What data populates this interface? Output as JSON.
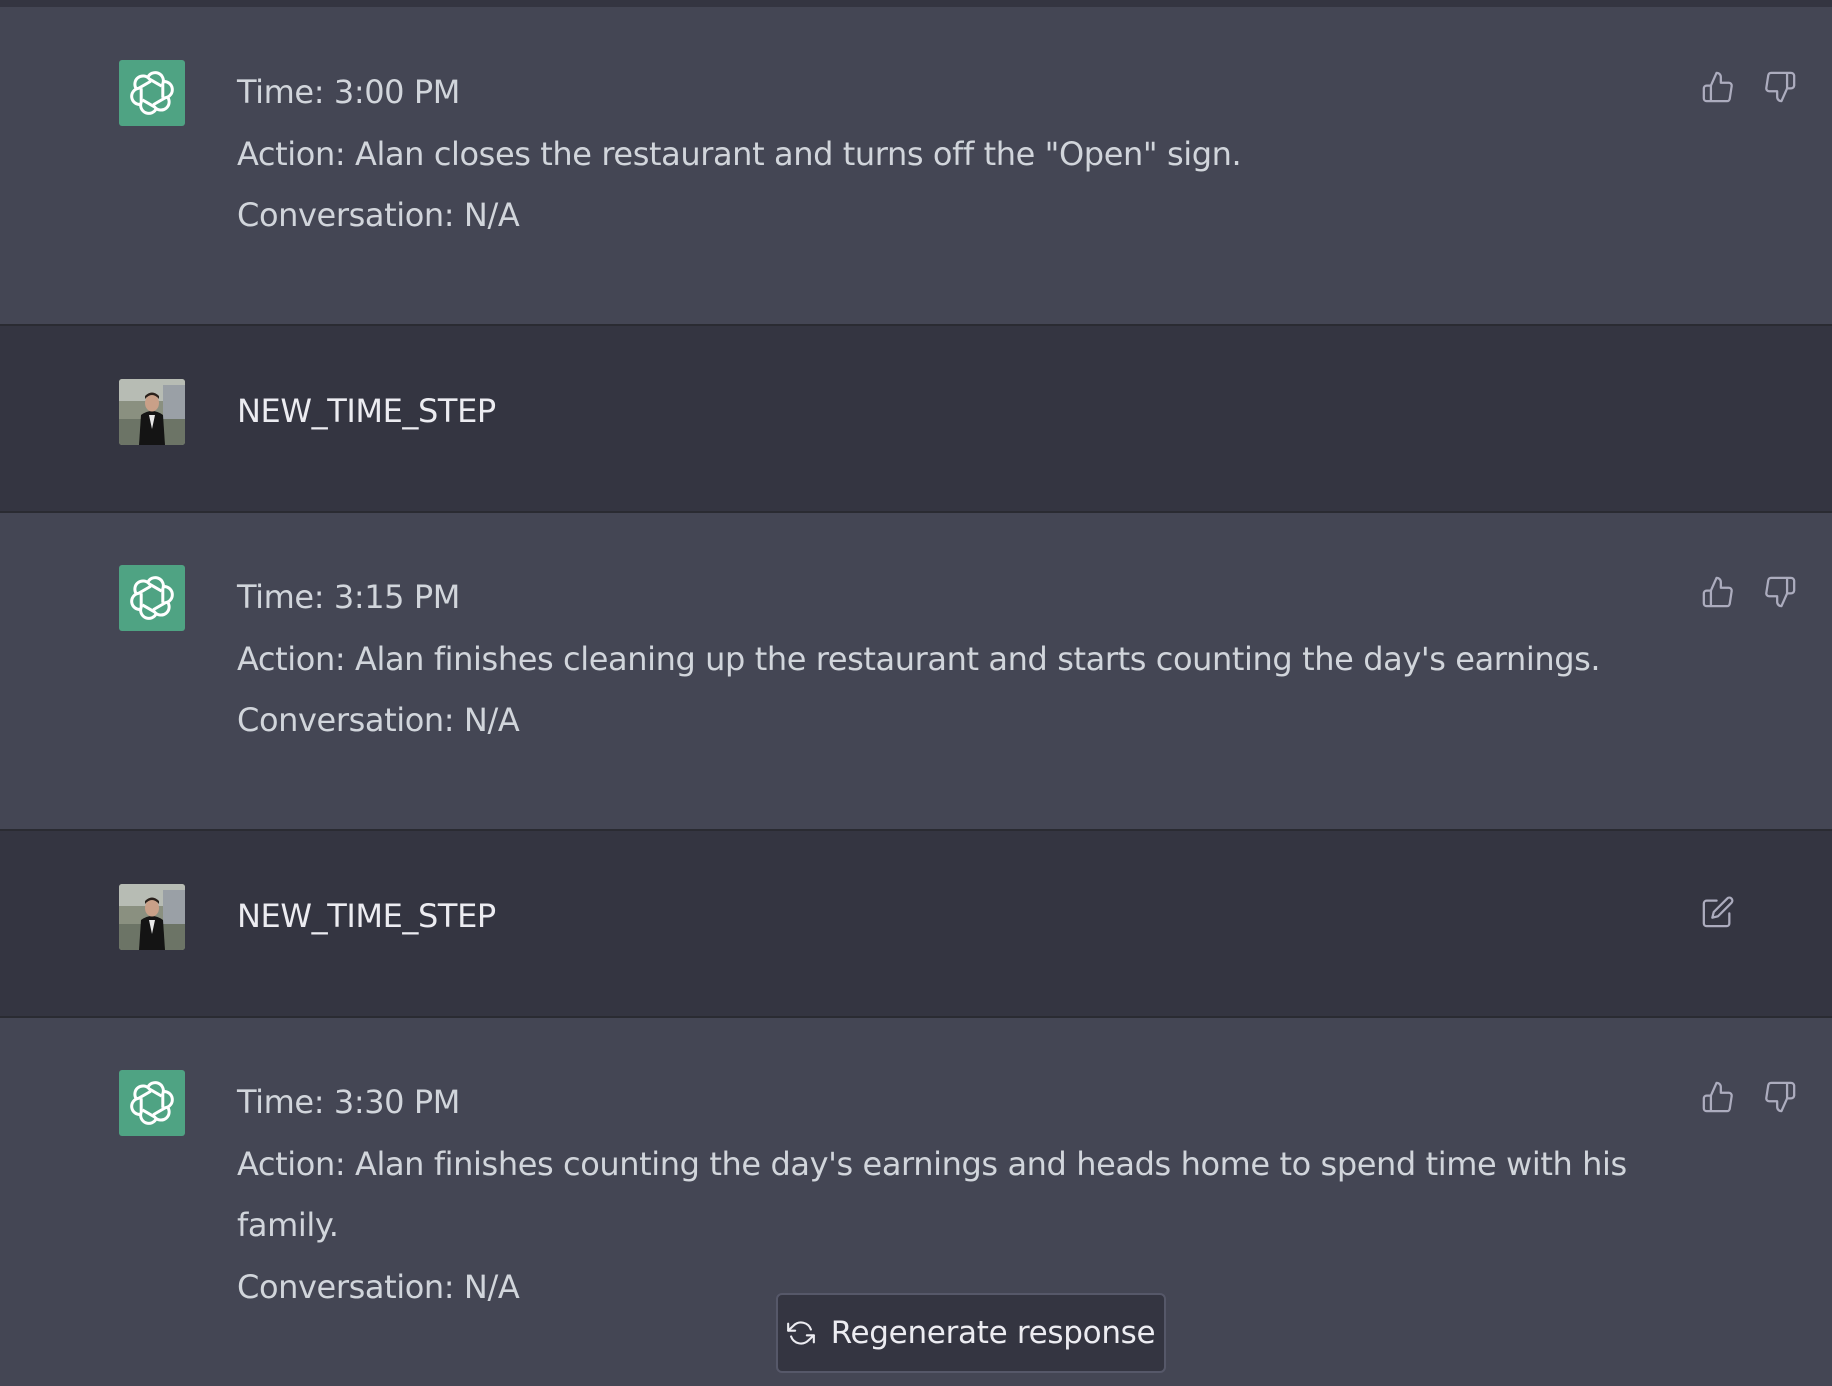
{
  "messages": [
    {
      "role": "assistant",
      "lines": [
        "Time: 3:00 PM",
        "Action: Alan closes the restaurant and turns off the \"Open\" sign.",
        "Conversation: N/A"
      ]
    },
    {
      "role": "user",
      "lines": [
        "NEW_TIME_STEP"
      ]
    },
    {
      "role": "assistant",
      "lines": [
        "Time: 3:15 PM",
        "Action: Alan finishes cleaning up the restaurant and starts counting the day's earnings.",
        "Conversation: N/A"
      ]
    },
    {
      "role": "user",
      "lines": [
        "NEW_TIME_STEP"
      ]
    },
    {
      "role": "assistant",
      "lines": [
        "Time: 3:30 PM",
        "Action: Alan finishes counting the day's earnings and heads home to spend time with his",
        "family.",
        "Conversation: N/A"
      ]
    }
  ],
  "regenerate_label": "Regenerate response",
  "icons": {
    "assistant_avatar": "openai-logo-icon",
    "user_avatar": "user-photo-avatar",
    "like": "thumbs-up-icon",
    "dislike": "thumbs-down-icon",
    "edit": "edit-icon",
    "regenerate": "refresh-icon"
  },
  "colors": {
    "assistant_bg": "#444654",
    "user_bg": "#343541",
    "assistant_avatar_bg": "#4fa383",
    "text": "#d1d5db"
  }
}
